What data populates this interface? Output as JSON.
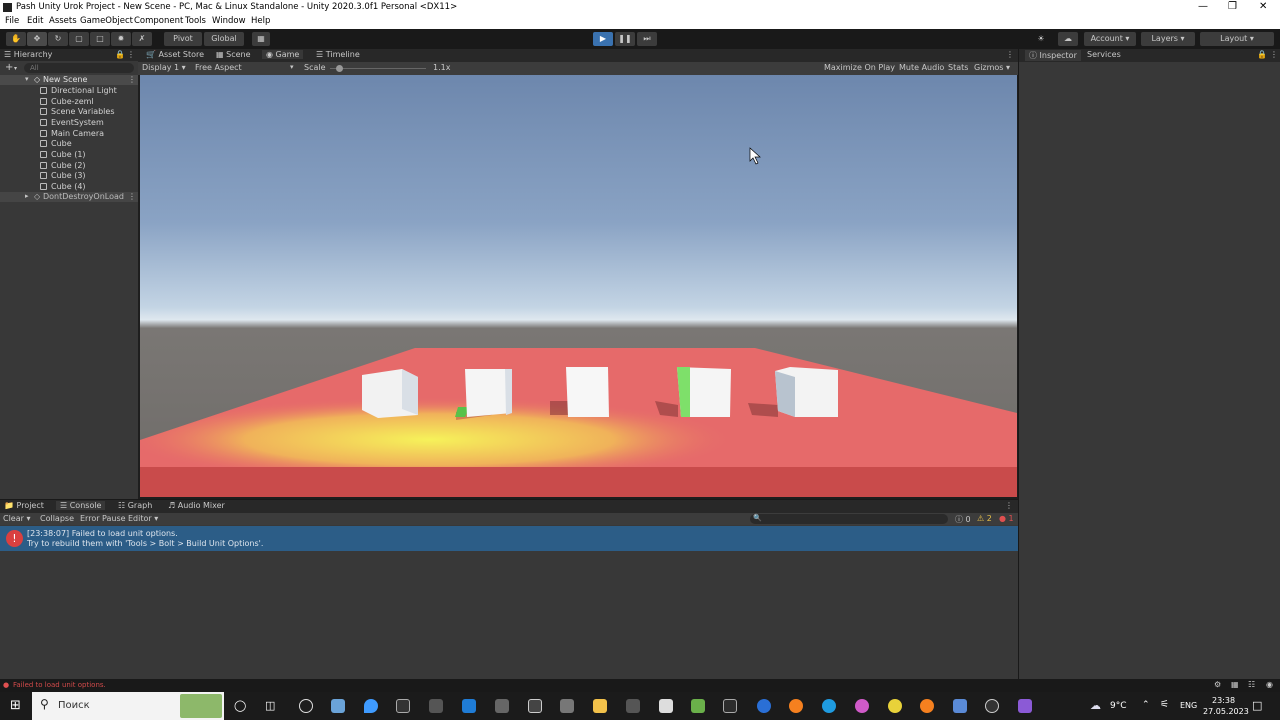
{
  "window": {
    "title": "Pash Unity Urok Project - New Scene - PC, Mac & Linux Standalone - Unity 2020.3.0f1 Personal <DX11>"
  },
  "menu": [
    "File",
    "Edit",
    "Assets",
    "GameObject",
    "Component",
    "Tools",
    "Window",
    "Help"
  ],
  "toolbar": {
    "pivot": "Pivot",
    "global": "Global",
    "account": "Account",
    "layers": "Layers",
    "layout": "Layout"
  },
  "hierarchy": {
    "tab": "Hierarchy",
    "search_placeholder": "All",
    "scene": "New Scene",
    "items": [
      "Directional Light",
      "Cube-zeml",
      "Scene Variables",
      "EventSystem",
      "Main Camera",
      "Cube",
      "Cube (1)",
      "Cube (2)",
      "Cube (3)",
      "Cube (4)"
    ],
    "dont_destroy": "DontDestroyOnLoad"
  },
  "center_tabs": [
    "Asset Store",
    "Scene",
    "Game",
    "Timeline"
  ],
  "game": {
    "display": "Display 1",
    "aspect": "Free Aspect",
    "scale_label": "Scale",
    "scale_value": "1.1x",
    "maximize": "Maximize On Play",
    "mute": "Mute Audio",
    "stats": "Stats",
    "gizmos": "Gizmos"
  },
  "right_tabs": [
    "Inspector",
    "Services"
  ],
  "bottom_tabs": [
    "Project",
    "Console",
    "Graph",
    "Audio Mixer"
  ],
  "console": {
    "clear": "Clear",
    "collapse": "Collapse",
    "error_pause": "Error Pause",
    "editor": "Editor",
    "count_info": "0",
    "count_warn": "2",
    "count_error": "1",
    "message_line1": "[23:38:07] Failed to load unit options.",
    "message_line2": "Try to rebuild them with 'Tools > Bolt > Build Unit Options'.",
    "status": "Failed to load unit options."
  },
  "taskbar": {
    "search": "Поиск",
    "weather": "9°C",
    "lang": "ENG",
    "time": "23:38",
    "date": "27.05.2023"
  },
  "colors": {
    "accent": "#3a72b0",
    "floor": "#e66a6a",
    "selection": "#2c5d87"
  }
}
